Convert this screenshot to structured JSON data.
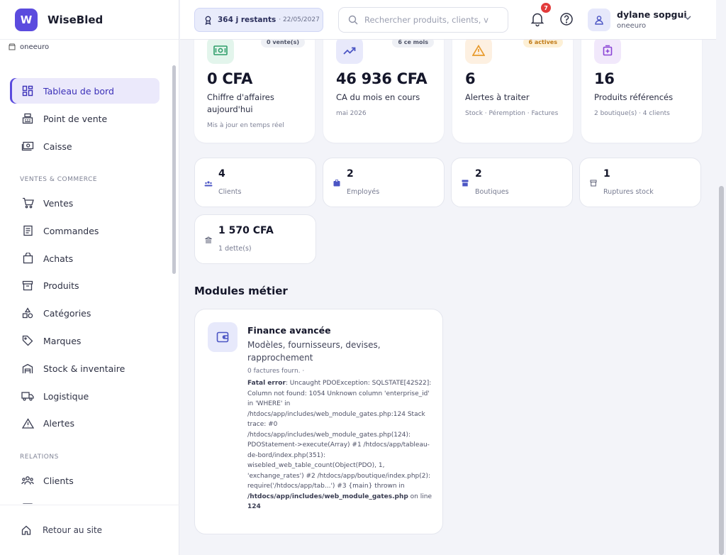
{
  "brand": {
    "name": "WiseBled",
    "logo_letter": "W",
    "shop": "oneeuro"
  },
  "sidebar": {
    "items": [
      {
        "label": "Tableau de bord",
        "icon": "dashboard-icon"
      },
      {
        "label": "Point de vente",
        "icon": "cash-register-icon"
      },
      {
        "label": "Caisse",
        "icon": "cash-icon"
      },
      {
        "label": "Ventes",
        "icon": "cart-icon"
      },
      {
        "label": "Commandes",
        "icon": "orders-icon"
      },
      {
        "label": "Achats",
        "icon": "bag-icon"
      },
      {
        "label": "Produits",
        "icon": "box-icon"
      },
      {
        "label": "Catégories",
        "icon": "shapes-icon"
      },
      {
        "label": "Marques",
        "icon": "tag-icon"
      },
      {
        "label": "Stock & inventaire",
        "icon": "warehouse-icon"
      },
      {
        "label": "Logistique",
        "icon": "truck-icon"
      },
      {
        "label": "Alertes",
        "icon": "warning-icon"
      },
      {
        "label": "Clients",
        "icon": "users-icon"
      }
    ],
    "sections": [
      "VENTES & COMMERCE",
      "RELATIONS"
    ],
    "footer": "Retour au site"
  },
  "topbar": {
    "subscription_days": "364 j restants",
    "subscription_date": "· 22/05/2027",
    "search_placeholder": "Rechercher produits, clients, v",
    "notifications": "7",
    "user_name": "dylane sopgui",
    "user_shop": "oneeuro"
  },
  "kpis": [
    {
      "value": "0 CFA",
      "label": "Chiffre d'affaires aujourd'hui",
      "meta": "Mis à jour en temps réel",
      "tag": "0 vente(s)",
      "icon": "money-icon"
    },
    {
      "value": "46 936 CFA",
      "label": "CA du mois en cours",
      "meta": "mai 2026",
      "tag": "6 ce mois",
      "icon": "trend-up-icon"
    },
    {
      "value": "6",
      "label": "Alertes à traiter",
      "meta": "Stock · Péremption · Factures",
      "tag": "6 actives",
      "icon": "warning-icon"
    },
    {
      "value": "16",
      "label": "Produits référencés",
      "meta": "2 boutique(s) · 4 clients",
      "tag": "",
      "icon": "medkit-icon"
    }
  ],
  "stats": [
    {
      "value": "4",
      "label": "Clients",
      "icon": "users-icon"
    },
    {
      "value": "2",
      "label": "Employés",
      "icon": "badge-icon"
    },
    {
      "value": "2",
      "label": "Boutiques",
      "icon": "store-icon"
    },
    {
      "value": "1",
      "label": "Ruptures stock",
      "icon": "box-icon"
    },
    {
      "value": "1 570 CFA",
      "label": "1 dette(s)",
      "icon": "bank-icon"
    }
  ],
  "modules": {
    "title": "Modules métier",
    "card": {
      "title": "Finance avancée",
      "description": "Modèles, fournisseurs, devises, rapprochement",
      "count": "0 factures fourn. ·",
      "error_label": "Fatal error",
      "error_text": ": Uncaught PDOException: SQLSTATE[42S22]: Column not found: 1054 Unknown column 'enterprise_id' in 'WHERE' in /htdocs/app/includes/web_module_gates.php:124 Stack trace: #0 /htdocs/app/includes/web_module_gates.php(124): PDOStatement->execute(Array) #1 /htdocs/app/tableau-de-bord/index.php(351): wisebled_web_table_count(Object(PDO), 1, 'exchange_rates') #2 /htdocs/app/boutique/index.php(2): require('/htdocs/app/tab...') #3 {main} thrown in",
      "error_file": "/htdocs/app/includes/web_module_gates.php",
      "error_line_prefix": " on line ",
      "error_line": "124"
    }
  },
  "colors": {
    "accent": "#5b4bde",
    "warning": "#e89a2c",
    "success": "#2f9e6a",
    "danger": "#e23b3b"
  }
}
